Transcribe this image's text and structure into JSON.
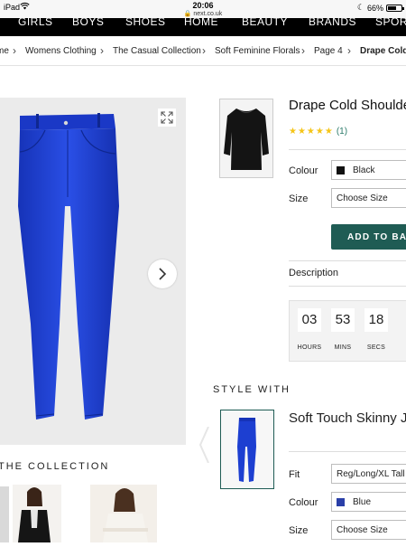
{
  "status_bar": {
    "device": "iPad",
    "time": "20:06",
    "url": "next.co.uk",
    "battery": "66%",
    "battery_level": 0.66
  },
  "top_nav": [
    "GIRLS",
    "BOYS",
    "SHOES",
    "HOME",
    "BEAUTY",
    "BRANDS",
    "SPORTS"
  ],
  "breadcrumb": [
    "me",
    "Womens Clothing",
    "The Casual Collection",
    "Soft Feminine Florals",
    "Page 4",
    "Drape Cold Sh"
  ],
  "product": {
    "title": "Drape Cold Shoulder",
    "stars": "★★★★★",
    "rating_count": "(1)",
    "colour_label": "Colour",
    "colour_value": "Black",
    "colour_swatch": "#111111",
    "size_label": "Size",
    "size_value": "Choose Size",
    "add_button": "ADD TO BAG",
    "description_label": "Description"
  },
  "countdown": {
    "hours": "03",
    "minutes": "53",
    "seconds": "18",
    "hours_label": "HOURS",
    "minutes_label": "MINS",
    "seconds_label": "SECS"
  },
  "style_with": {
    "heading": "STYLE WITH",
    "title": "Soft Touch Skinny J",
    "fit_label": "Fit",
    "fit_value": "Reg/Long/XL Tall",
    "colour_label": "Colour",
    "colour_value": "Blue",
    "colour_swatch": "#2a3fa8",
    "size_label": "Size",
    "size_value": "Choose Size"
  },
  "collection": {
    "heading": "THE COLLECTION"
  },
  "colors": {
    "accent": "#1f5c54",
    "jeans": "#1d3fd1",
    "star": "#f5c518"
  }
}
